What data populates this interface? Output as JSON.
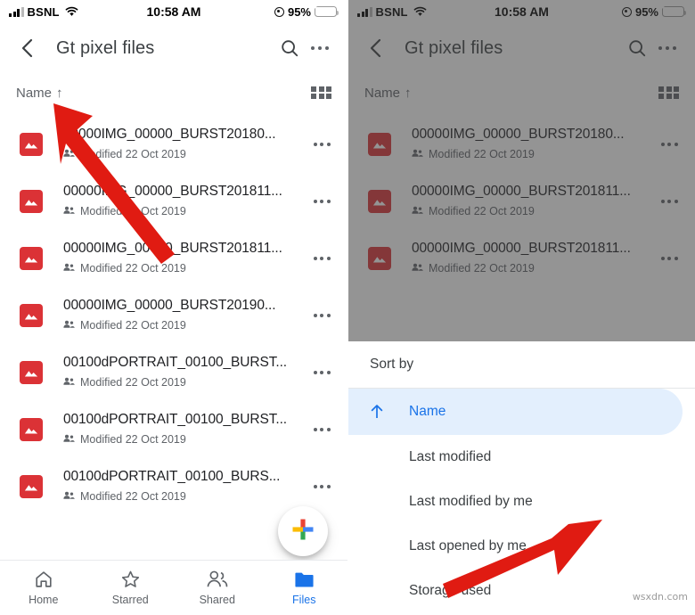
{
  "status_bar": {
    "carrier": "BSNL",
    "time": "10:58 AM",
    "battery_percent": "95%",
    "wifi_icon": "wifi-icon",
    "signal_icon": "signal-bars-icon",
    "location_icon": "location-services-icon",
    "battery_icon": "battery-charging-icon"
  },
  "app_bar": {
    "back_icon": "back-chevron-icon",
    "title": "Gt pixel files",
    "search_icon": "search-icon",
    "overflow_icon": "more-vertical-icon"
  },
  "sort_bar": {
    "label": "Name",
    "direction_arrow": "↑",
    "view_toggle_icon": "grid-view-icon"
  },
  "files": [
    {
      "name": "00000IMG_00000_BURST20180...",
      "modified": "Modified 22 Oct 2019",
      "icon": "image-file-icon",
      "shared_icon": "shared-people-icon",
      "overflow": "more-vertical-icon"
    },
    {
      "name": "00000IMG_00000_BURST201811...",
      "modified": "Modified 22 Oct 2019",
      "icon": "image-file-icon",
      "shared_icon": "shared-people-icon",
      "overflow": "more-vertical-icon"
    },
    {
      "name": "00000IMG_00000_BURST201811...",
      "modified": "Modified 22 Oct 2019",
      "icon": "image-file-icon",
      "shared_icon": "shared-people-icon",
      "overflow": "more-vertical-icon"
    },
    {
      "name": "00000IMG_00000_BURST20190...",
      "modified": "Modified 22 Oct 2019",
      "icon": "image-file-icon",
      "shared_icon": "shared-people-icon",
      "overflow": "more-vertical-icon"
    },
    {
      "name": "00100dPORTRAIT_00100_BURST...",
      "modified": "Modified 22 Oct 2019",
      "icon": "image-file-icon",
      "shared_icon": "shared-people-icon",
      "overflow": "more-vertical-icon"
    },
    {
      "name": "00100dPORTRAIT_00100_BURST...",
      "modified": "Modified 22 Oct 2019",
      "icon": "image-file-icon",
      "shared_icon": "shared-people-icon",
      "overflow": "more-vertical-icon"
    },
    {
      "name": "00100dPORTRAIT_00100_BURS...",
      "modified": "Modified 22 Oct 2019",
      "icon": "image-file-icon",
      "shared_icon": "shared-people-icon",
      "overflow": "more-vertical-icon"
    }
  ],
  "fab": {
    "icon": "google-plus-add-icon"
  },
  "bottom_nav": [
    {
      "label": "Home",
      "icon": "home-icon",
      "active": false
    },
    {
      "label": "Starred",
      "icon": "star-icon",
      "active": false
    },
    {
      "label": "Shared",
      "icon": "people-icon",
      "active": false
    },
    {
      "label": "Files",
      "icon": "folder-icon",
      "active": true
    }
  ],
  "sort_sheet": {
    "title": "Sort by",
    "options": [
      {
        "label": "Name",
        "selected": true,
        "arrow": "↑"
      },
      {
        "label": "Last modified",
        "selected": false
      },
      {
        "label": "Last modified by me",
        "selected": false
      },
      {
        "label": "Last opened by me",
        "selected": false
      },
      {
        "label": "Storage used",
        "selected": false
      }
    ]
  },
  "annotations": [
    {
      "name": "arrow-pointing-to-name-sort",
      "panel": "left"
    },
    {
      "name": "arrow-pointing-to-storage-used",
      "panel": "right"
    }
  ],
  "watermark": "wsxdn.com",
  "colors": {
    "accent_blue": "#1a73e8",
    "selected_row_bg": "#e3effd",
    "file_icon_red": "#db3236",
    "text_primary": "#202124",
    "text_secondary": "#5f6368",
    "annotation_red": "#e01b12",
    "scrim": "rgba(60,60,60,0.55)",
    "battery_green": "#34c759"
  }
}
